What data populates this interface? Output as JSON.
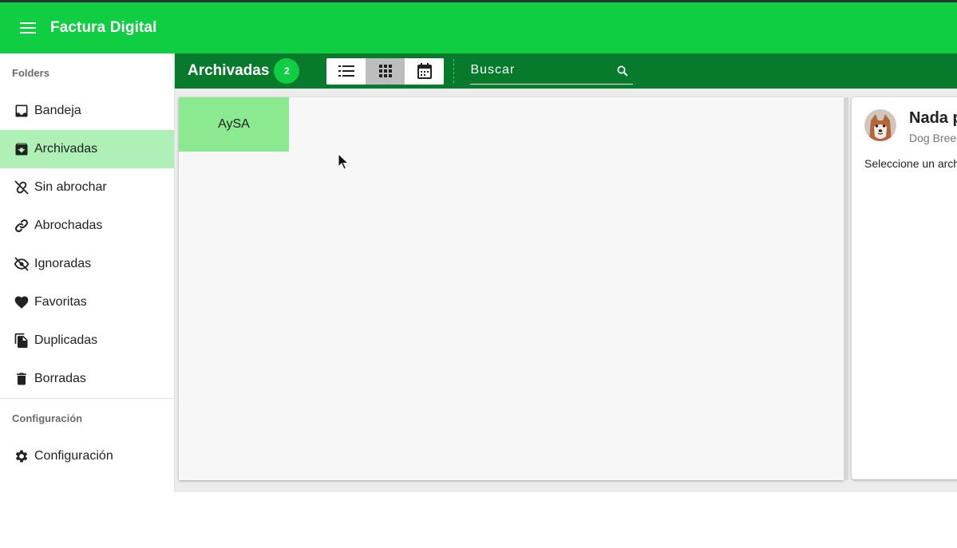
{
  "app": {
    "title": "Factura Digital"
  },
  "sidebar": {
    "folders_label": "Folders",
    "items": [
      {
        "label": "Bandeja",
        "icon": "inbox-icon"
      },
      {
        "label": "Archivadas",
        "icon": "archive-icon",
        "active": true
      },
      {
        "label": "Sin abrochar",
        "icon": "link-off-icon"
      },
      {
        "label": "Abrochadas",
        "icon": "link-icon"
      },
      {
        "label": "Ignoradas",
        "icon": "eye-off-icon"
      },
      {
        "label": "Favoritas",
        "icon": "heart-icon"
      },
      {
        "label": "Duplicadas",
        "icon": "copy-icon"
      },
      {
        "label": "Borradas",
        "icon": "trash-icon"
      }
    ],
    "config_label": "Configuración",
    "config_item": {
      "label": "Configuración",
      "icon": "gear-icon"
    }
  },
  "toolbar": {
    "folder_title": "Archivadas",
    "count": "2",
    "views": [
      {
        "name": "list-view",
        "icon": "list-icon"
      },
      {
        "name": "grid-view",
        "icon": "grid-icon",
        "selected": true
      },
      {
        "name": "calendar-view",
        "icon": "calendar-icon"
      }
    ],
    "search": {
      "placeholder": "Buscar",
      "value": ""
    }
  },
  "grid": {
    "tiles": [
      {
        "label": "AySA"
      }
    ]
  },
  "detail": {
    "title": "Nada p",
    "subtitle": "Dog Breed",
    "text": "Seleccione un arch"
  },
  "colors": {
    "primary": "#0fce42",
    "primary_dark": "#087a2c",
    "active_item": "#aef0b6",
    "tile": "#8be98f"
  }
}
